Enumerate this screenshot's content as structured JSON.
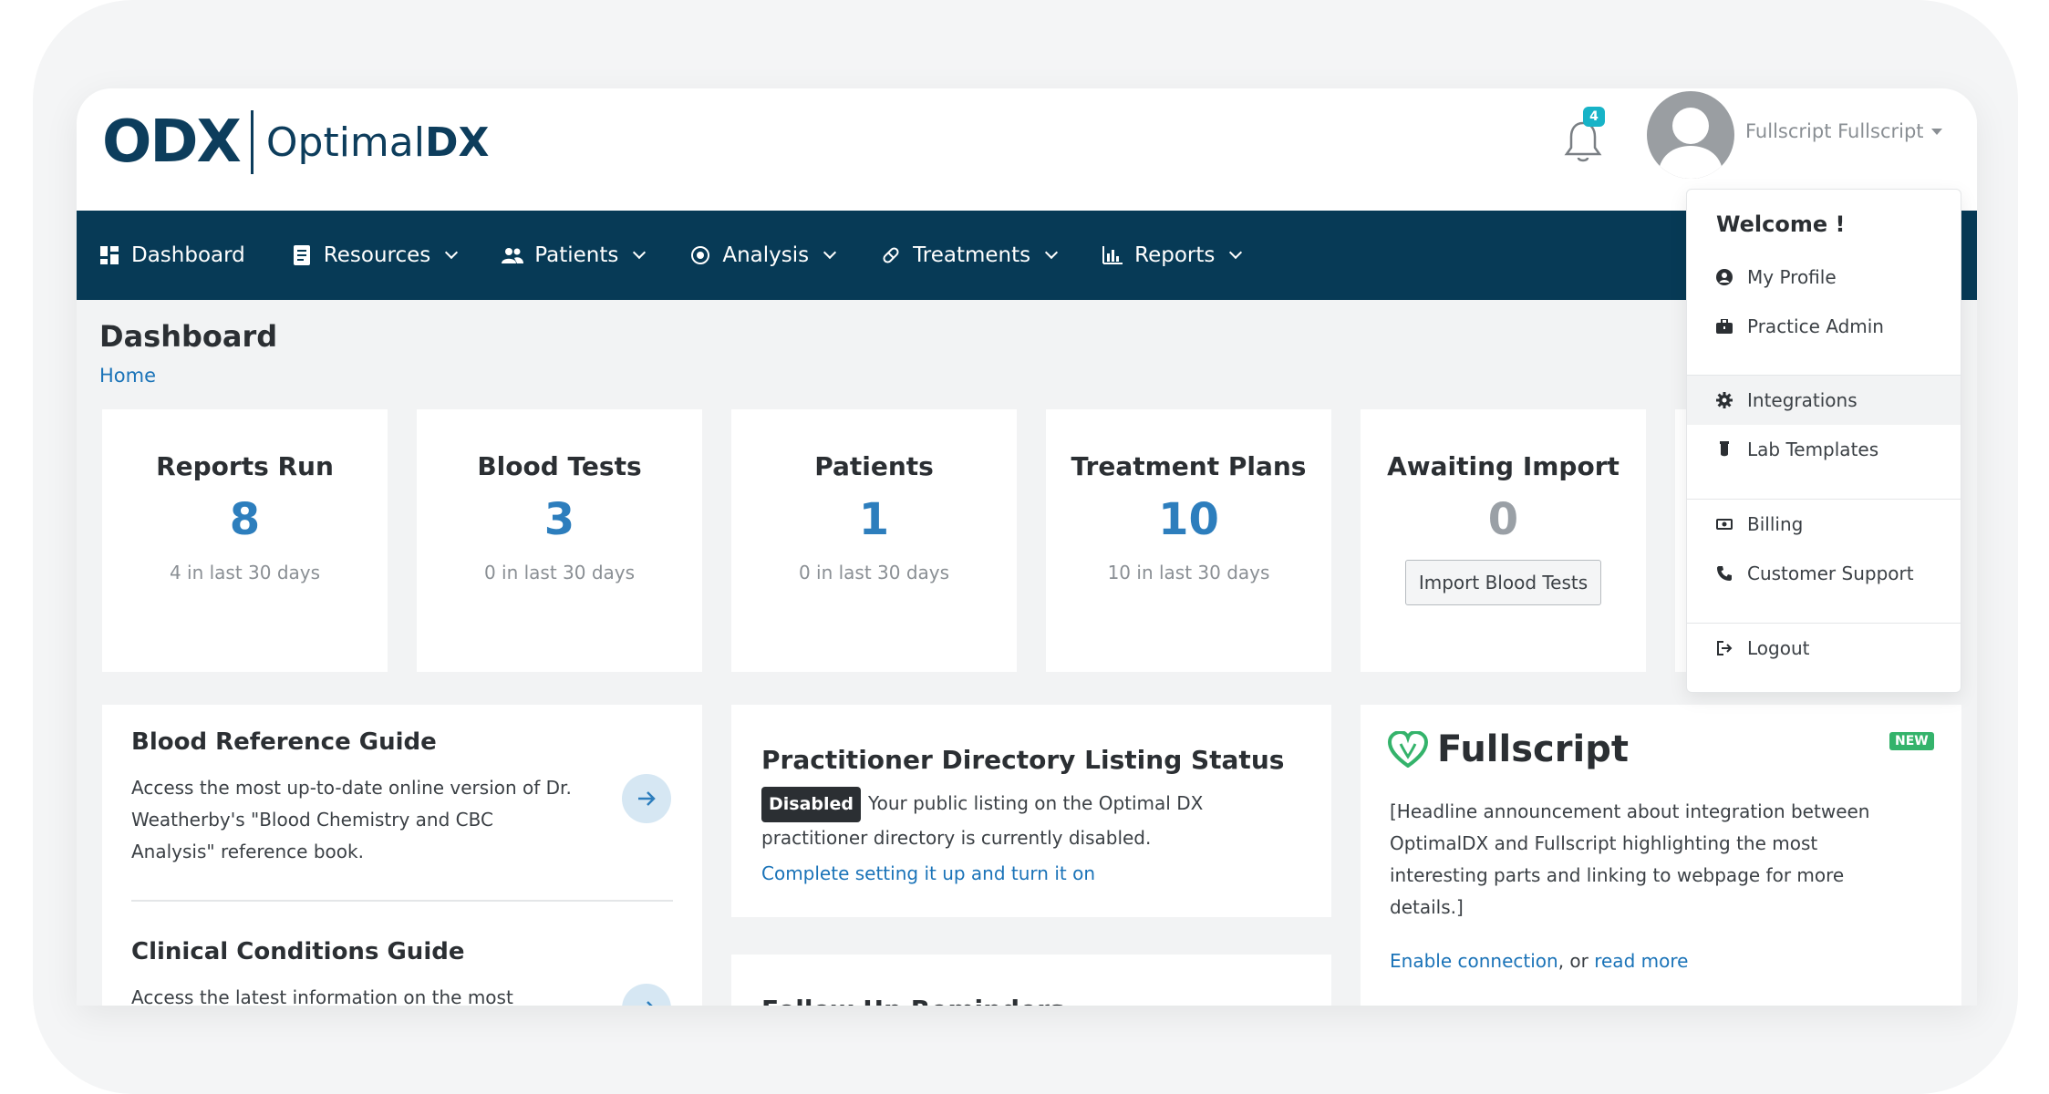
{
  "header": {
    "logo_mark": "ODX",
    "logo_name_light": "Optimal",
    "logo_name_bold": "DX",
    "notification_count": "4",
    "user_name": "Fullscript Fullscript"
  },
  "nav": {
    "items": [
      {
        "label": "Dashboard",
        "icon": "grid-icon"
      },
      {
        "label": "Resources",
        "icon": "book-icon"
      },
      {
        "label": "Patients",
        "icon": "users-icon"
      },
      {
        "label": "Analysis",
        "icon": "target-icon"
      },
      {
        "label": "Treatments",
        "icon": "pill-icon"
      },
      {
        "label": "Reports",
        "icon": "bar-chart-icon"
      }
    ]
  },
  "page": {
    "title": "Dashboard",
    "breadcrumb": "Home"
  },
  "stats": [
    {
      "title": "Reports Run",
      "value": "8",
      "sub": "4 in last 30 days"
    },
    {
      "title": "Blood Tests",
      "value": "3",
      "sub": "0 in last 30 days"
    },
    {
      "title": "Patients",
      "value": "1",
      "sub": "0 in last 30 days"
    },
    {
      "title": "Treatment Plans",
      "value": "10",
      "sub": "10 in last 30 days"
    },
    {
      "title": "Awaiting Import",
      "value": "0",
      "button": "Import Blood Tests"
    }
  ],
  "guides": {
    "blood_title": "Blood Reference Guide",
    "blood_line1": "Access the most up-to-date online version of Dr.",
    "blood_line2": "Weatherby's \"Blood Chemistry and CBC",
    "blood_line3": "Analysis\" reference book.",
    "clinical_title": "Clinical Conditions Guide",
    "clinical_line1": "Access the latest information on the most"
  },
  "directory": {
    "title": "Practitioner Directory Listing Status",
    "badge": "Disabled",
    "line1": "Your public listing on the Optimal DX",
    "line2": "practitioner directory is currently disabled.",
    "link": "Complete setting it up and turn it on",
    "next_title": "Follow Up Reminders"
  },
  "fullscript": {
    "brand": "Fullscript",
    "badge": "NEW",
    "line1": "[Headline announcement about integration between",
    "line2": "OptimalDX and Fullscript highlighting the most",
    "line3": "interesting parts and linking to webpage for more",
    "line4": "details.]",
    "link1": "Enable connection",
    "mid": ", or ",
    "link2": "read more"
  },
  "dropdown": {
    "welcome": "Welcome !",
    "items": [
      {
        "label": "My Profile",
        "icon": "user-circle-icon"
      },
      {
        "label": "Practice Admin",
        "icon": "briefcase-icon"
      },
      {
        "label": "Integrations",
        "icon": "gear-icon"
      },
      {
        "label": "Lab Templates",
        "icon": "test-tube-icon"
      },
      {
        "label": "Billing",
        "icon": "money-icon"
      },
      {
        "label": "Customer Support",
        "icon": "phone-icon"
      },
      {
        "label": "Logout",
        "icon": "logout-icon"
      }
    ]
  },
  "colors": {
    "nav_bg": "#073a56",
    "accent_blue": "#2d7ebd",
    "link": "#1a73b8",
    "badge_teal": "#17b3c7",
    "new_green": "#34b36b"
  }
}
